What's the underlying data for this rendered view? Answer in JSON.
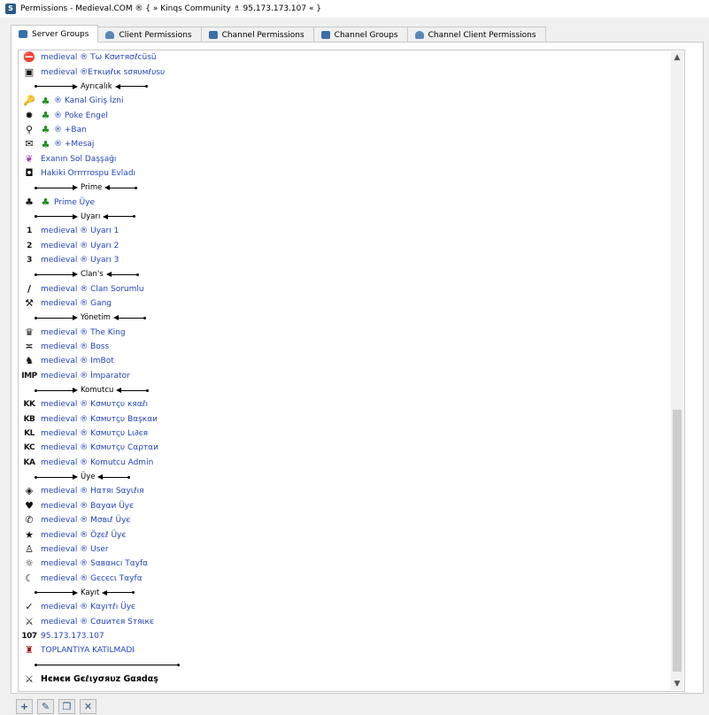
{
  "window": {
    "title": "Permissions - Medieval.COM ® { » Kinqs Community ♗ 95.173.173.107 « }"
  },
  "tabs": [
    {
      "label": "Server Groups",
      "active": true
    },
    {
      "label": "Client Permissions"
    },
    {
      "label": "Channel Permissions"
    },
    {
      "label": "Channel Groups"
    },
    {
      "label": "Channel Client Permissions"
    }
  ],
  "groups": [
    {
      "kind": "item",
      "icon": "no-entry-icon",
      "glyph": "⛔",
      "label": "medieval ® Tω Kσитяσℓcüsü"
    },
    {
      "kind": "item",
      "icon": "badge-icon",
      "glyph": "▣",
      "label": "medieval ®Eткιиℓιк ѕσяυмℓυѕυ"
    },
    {
      "kind": "sep",
      "label": "Ayrıcalık",
      "w1": 40,
      "w2": 28
    },
    {
      "kind": "item",
      "icon": "key-icon",
      "glyph": "🔑",
      "clover": true,
      "label": "® Kanal Giriş İzni"
    },
    {
      "kind": "item",
      "icon": "splat-icon",
      "glyph": "✹",
      "clover": true,
      "label": "® Poke Engel"
    },
    {
      "kind": "item",
      "icon": "magnifier-icon",
      "glyph": "⚲",
      "clover": true,
      "label": "® +Ban"
    },
    {
      "kind": "item",
      "icon": "message-icon",
      "glyph": "✉",
      "clover": true,
      "label": "® +Mesaj"
    },
    {
      "kind": "item",
      "icon": "butterfly-icon",
      "glyph": "❦",
      "label": "Exanın Sol Daşşağı",
      "color": "#a040c0"
    },
    {
      "kind": "item",
      "icon": "portrait-icon",
      "glyph": "◘",
      "label": "Hakiki Orrrrrospu Evladı"
    },
    {
      "kind": "sep",
      "label": "Prime",
      "w1": 40,
      "w2": 28
    },
    {
      "kind": "item",
      "icon": "money-bag-icon",
      "glyph": "♣",
      "clover": true,
      "label": "Prime Üye"
    },
    {
      "kind": "sep",
      "label": "Uyarı",
      "w1": 40,
      "w2": 28
    },
    {
      "kind": "item",
      "icon": "number-1-icon",
      "glyph": "1",
      "text": true,
      "label": "medieval ® Uyarı 1"
    },
    {
      "kind": "item",
      "icon": "number-2-icon",
      "glyph": "2",
      "text": true,
      "label": "medieval ® Uyarı 2"
    },
    {
      "kind": "item",
      "icon": "number-3-icon",
      "glyph": "3",
      "text": true,
      "label": "medieval ® Uyarı 3"
    },
    {
      "kind": "sep",
      "label": "Clan's",
      "w1": 40,
      "w2": 28
    },
    {
      "kind": "item",
      "icon": "knife-icon",
      "glyph": "/",
      "label": "medieval ® Clan Sorumlu"
    },
    {
      "kind": "item",
      "icon": "hammer-icon",
      "glyph": "⚒",
      "label": "medieval ® Gang"
    },
    {
      "kind": "sep",
      "label": "Yönetim",
      "w1": 40,
      "w2": 28
    },
    {
      "kind": "item",
      "icon": "crown-icon",
      "glyph": "♛",
      "label": "medieval ® The King"
    },
    {
      "kind": "item",
      "icon": "mask-icon",
      "glyph": "≍",
      "label": "medieval ® Boss"
    },
    {
      "kind": "item",
      "icon": "spartan-helmet-icon",
      "glyph": "♞",
      "label": "medieval ® ImBot"
    },
    {
      "kind": "item",
      "icon": "imp-text-icon",
      "glyph": "IMP",
      "text": true,
      "label": "medieval ® İmparator"
    },
    {
      "kind": "sep",
      "label": "Komutcu",
      "w1": 40,
      "w2": 28
    },
    {
      "kind": "item",
      "icon": "kk-text-icon",
      "glyph": "KK",
      "text": true,
      "label": "medieval ® Kσмυтçυ кяαℓı"
    },
    {
      "kind": "item",
      "icon": "kb-text-icon",
      "glyph": "KB",
      "text": true,
      "label": "medieval ® Kσмυтçυ Bαşкαи"
    },
    {
      "kind": "item",
      "icon": "kl-text-icon",
      "glyph": "KL",
      "text": true,
      "label": "medieval ® Kσмυтçυ Lι∂єя"
    },
    {
      "kind": "item",
      "icon": "kc-text-icon",
      "glyph": "KC",
      "text": true,
      "label": "medieval ® Kσмυтçυ Cαρтαи"
    },
    {
      "kind": "item",
      "icon": "ka-text-icon",
      "glyph": "KA",
      "text": true,
      "label": "medieval ® Komutcu Admin"
    },
    {
      "kind": "sep",
      "label": "Üye",
      "w1": 40,
      "w2": 28
    },
    {
      "kind": "item",
      "icon": "diamond-icon",
      "glyph": "◈",
      "label": "medieval ® Hαтяı Sαуιℓıя"
    },
    {
      "kind": "item",
      "icon": "heart-icon",
      "glyph": "♥",
      "label": "medieval ® Bαуαи Üує"
    },
    {
      "kind": "item",
      "icon": "phone-icon",
      "glyph": "✆",
      "label": "medieval ® Mσвιℓ Üує"
    },
    {
      "kind": "item",
      "icon": "star-icon",
      "glyph": "★",
      "label": "medieval ® Öẓєℓ Üує"
    },
    {
      "kind": "item",
      "icon": "user-icon",
      "glyph": "♙",
      "label": "medieval ® User"
    },
    {
      "kind": "item",
      "icon": "sun-icon",
      "glyph": "☼",
      "label": "medieval ® Sαвαнcı Tαyfα"
    },
    {
      "kind": "item",
      "icon": "moon-icon",
      "glyph": "☾",
      "label": "medieval ® Gєcєcι Tαyfα"
    },
    {
      "kind": "sep",
      "label": "Kayıt",
      "w1": 40,
      "w2": 28
    },
    {
      "kind": "item",
      "icon": "checkmark-icon",
      "glyph": "✓",
      "label": "medieval ® Kαуıтℓı Üує"
    },
    {
      "kind": "item",
      "icon": "counter-strike-icon",
      "glyph": "⚔",
      "label": "medieval ® Cσuитєя Sтяιкє"
    },
    {
      "kind": "item",
      "icon": "107-text-icon",
      "glyph": "107",
      "text": true,
      "label": "95.173.173.107"
    },
    {
      "kind": "item",
      "icon": "castle-icon",
      "glyph": "♜",
      "label": "TOPLANTIYA KATILMADI",
      "color": "#a01818"
    },
    {
      "kind": "line"
    },
    {
      "kind": "item",
      "icon": "crossed-swords-icon",
      "glyph": "⚔",
      "label": "Hємєи Gєℓιуσяυz Gαяdαş",
      "black": true
    }
  ],
  "toolbar": {
    "buttons": [
      {
        "name": "add-button",
        "glyph": "+"
      },
      {
        "name": "rename-button",
        "glyph": "✎"
      },
      {
        "name": "copy-button",
        "glyph": "❐"
      },
      {
        "name": "delete-button",
        "glyph": "✕"
      }
    ]
  }
}
